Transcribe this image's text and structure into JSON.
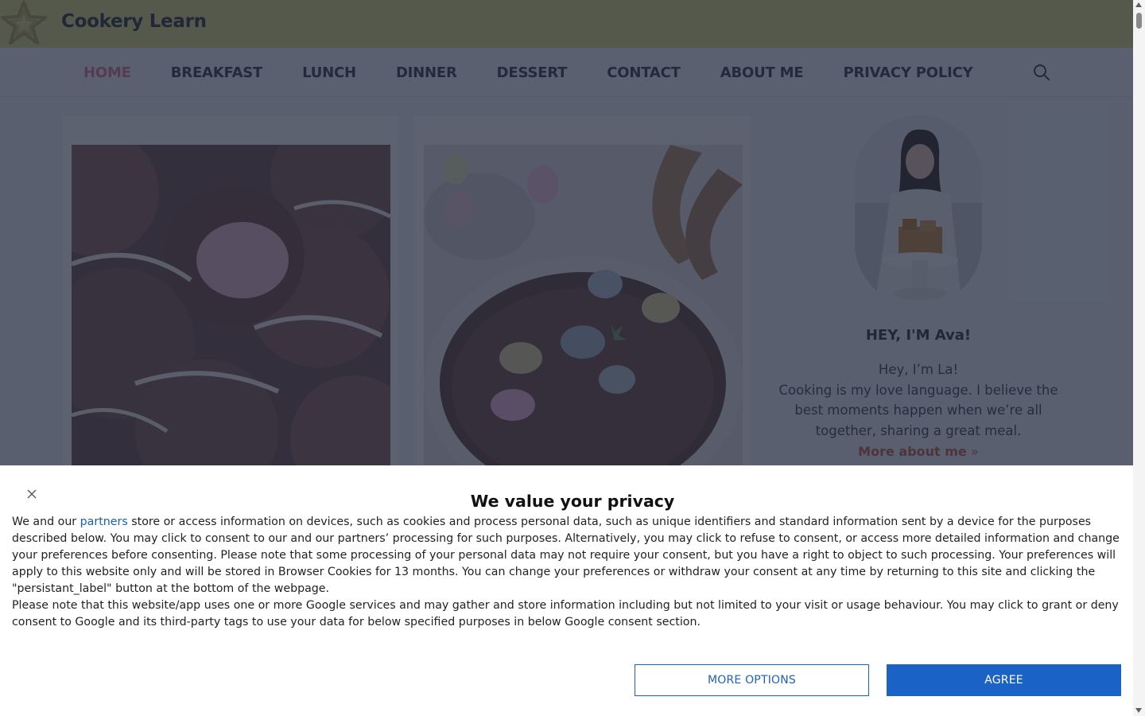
{
  "site": {
    "brand": "Cookery Learn",
    "nav": [
      "HOME",
      "BREAKFAST",
      "LUNCH",
      "DINNER",
      "DESSERT",
      "CONTACT",
      "ABOUT ME",
      "PRIVACY POLICY"
    ],
    "active_nav": "HOME",
    "sidebar": {
      "title": "HEY, I'M Ava!",
      "greeting": "Hey, I’m La!",
      "bio": "Cooking is my love language. I believe the best moments happen when we’re all together, sharing a great meal.",
      "more_link": "More about me",
      "more_arrow": "»"
    }
  },
  "consent": {
    "title": "We value your privacy",
    "intro_before_link": "We and our",
    "partners_link": "partners",
    "paragraph1_rest": "store or access information on devices, such as cookies and process personal data, such as unique identifiers and standard information sent by a device for the purposes described below. You may click to consent to our and our partners’ processing for such purposes. Alternatively, you may click to refuse to consent, or access more detailed information and change your preferences before consenting. Please note that some processing of your personal data may not require your consent, but you have a right to object to such processing. Your preferences will apply to this website only and will be stored in Browser Cookies for 13 months. You can change your preferences or withdraw your consent at any time by returning to this site and clicking the \"persistant_label\" button at the bottom of the webpage.",
    "paragraph2": "Please note that this website/app uses one or more Google services and may gather and store information including but not limited to your visit or usage behaviour. You may click to grant or deny consent to Google and its third-party tags to use your data for below specified purposes in below Google consent section.",
    "more_options_label": "MORE OPTIONS",
    "agree_label": "AGREE"
  },
  "colors": {
    "topbar": "#dedd77",
    "nav_active": "#e07590",
    "accent_link": "#c85b36",
    "button_blue": "#1a62c6"
  },
  "icons": {
    "logo": "star-logo-icon",
    "search": "search-icon",
    "close": "close-icon"
  }
}
